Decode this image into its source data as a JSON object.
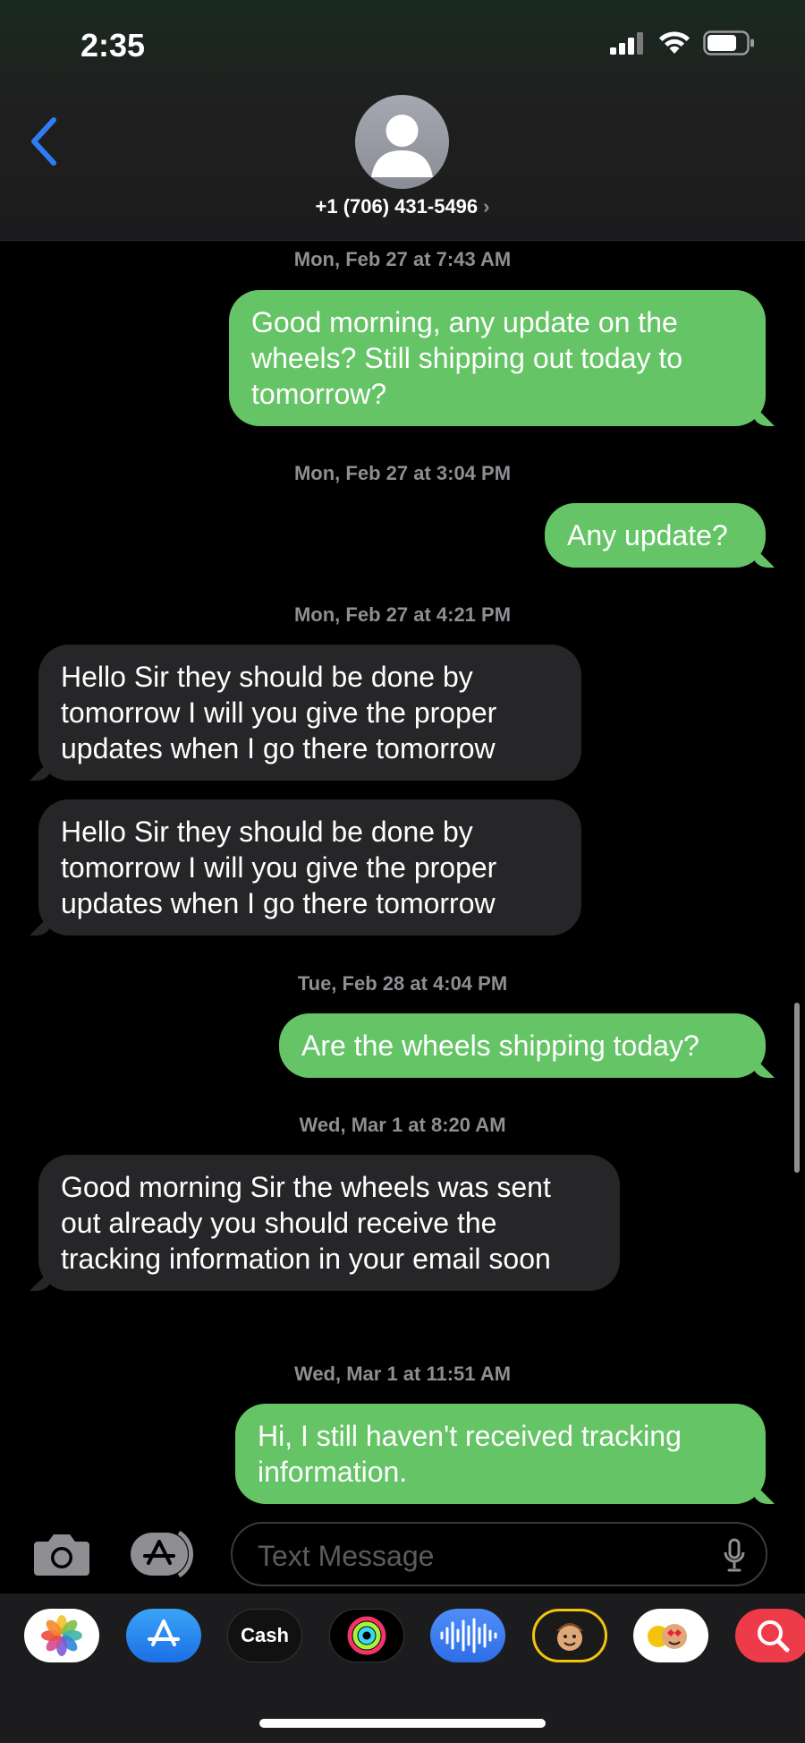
{
  "status_bar": {
    "time": "2:35"
  },
  "header": {
    "contact": "+1 (706) 431-5496",
    "contact_chevron": "›"
  },
  "messages": [
    {
      "type": "stamp",
      "text": "Mon, Feb 27 at 7:43 AM"
    },
    {
      "type": "sent",
      "text": "Good morning, any update on the wheels? Still shipping out today to tomorrow?"
    },
    {
      "type": "stamp",
      "text": "Mon, Feb 27 at 3:04 PM"
    },
    {
      "type": "sent",
      "text": "Any update?"
    },
    {
      "type": "stamp",
      "text": "Mon, Feb 27 at 4:21 PM"
    },
    {
      "type": "received",
      "text": "Hello Sir they should be done by tomorrow I will you give the proper updates when I go there tomorrow"
    },
    {
      "type": "received",
      "text": "Hello Sir they should be done by tomorrow I will you give the proper updates when I go there tomorrow"
    },
    {
      "type": "stamp",
      "text": "Tue, Feb 28 at 4:04 PM"
    },
    {
      "type": "sent",
      "text": "Are the wheels shipping today?"
    },
    {
      "type": "stamp",
      "text": "Wed, Mar 1 at 8:20 AM"
    },
    {
      "type": "received",
      "text": "Good morning Sir the wheels was sent out already you should receive the tracking information in your email soon"
    },
    {
      "type": "stamp",
      "text": "Wed, Mar 1 at 11:51 AM"
    },
    {
      "type": "sent",
      "text": "Hi, I still haven't received tracking information."
    }
  ],
  "composer": {
    "placeholder": "Text Message"
  },
  "app_bar": {
    "cash_label": "Cash",
    "apple_glyph": "",
    "apps": [
      "photos-icon",
      "app-store-icon",
      "apple-cash-icon",
      "fitness-icon",
      "audio-message-icon",
      "memoji-icon",
      "memoji-stickers-icon",
      "image-search-icon"
    ]
  },
  "colors": {
    "sent_bubble": "#65c466",
    "received_bubble": "#262628",
    "accent_blue": "#2f7cf6",
    "timestamp_gray": "#8e8e93"
  }
}
